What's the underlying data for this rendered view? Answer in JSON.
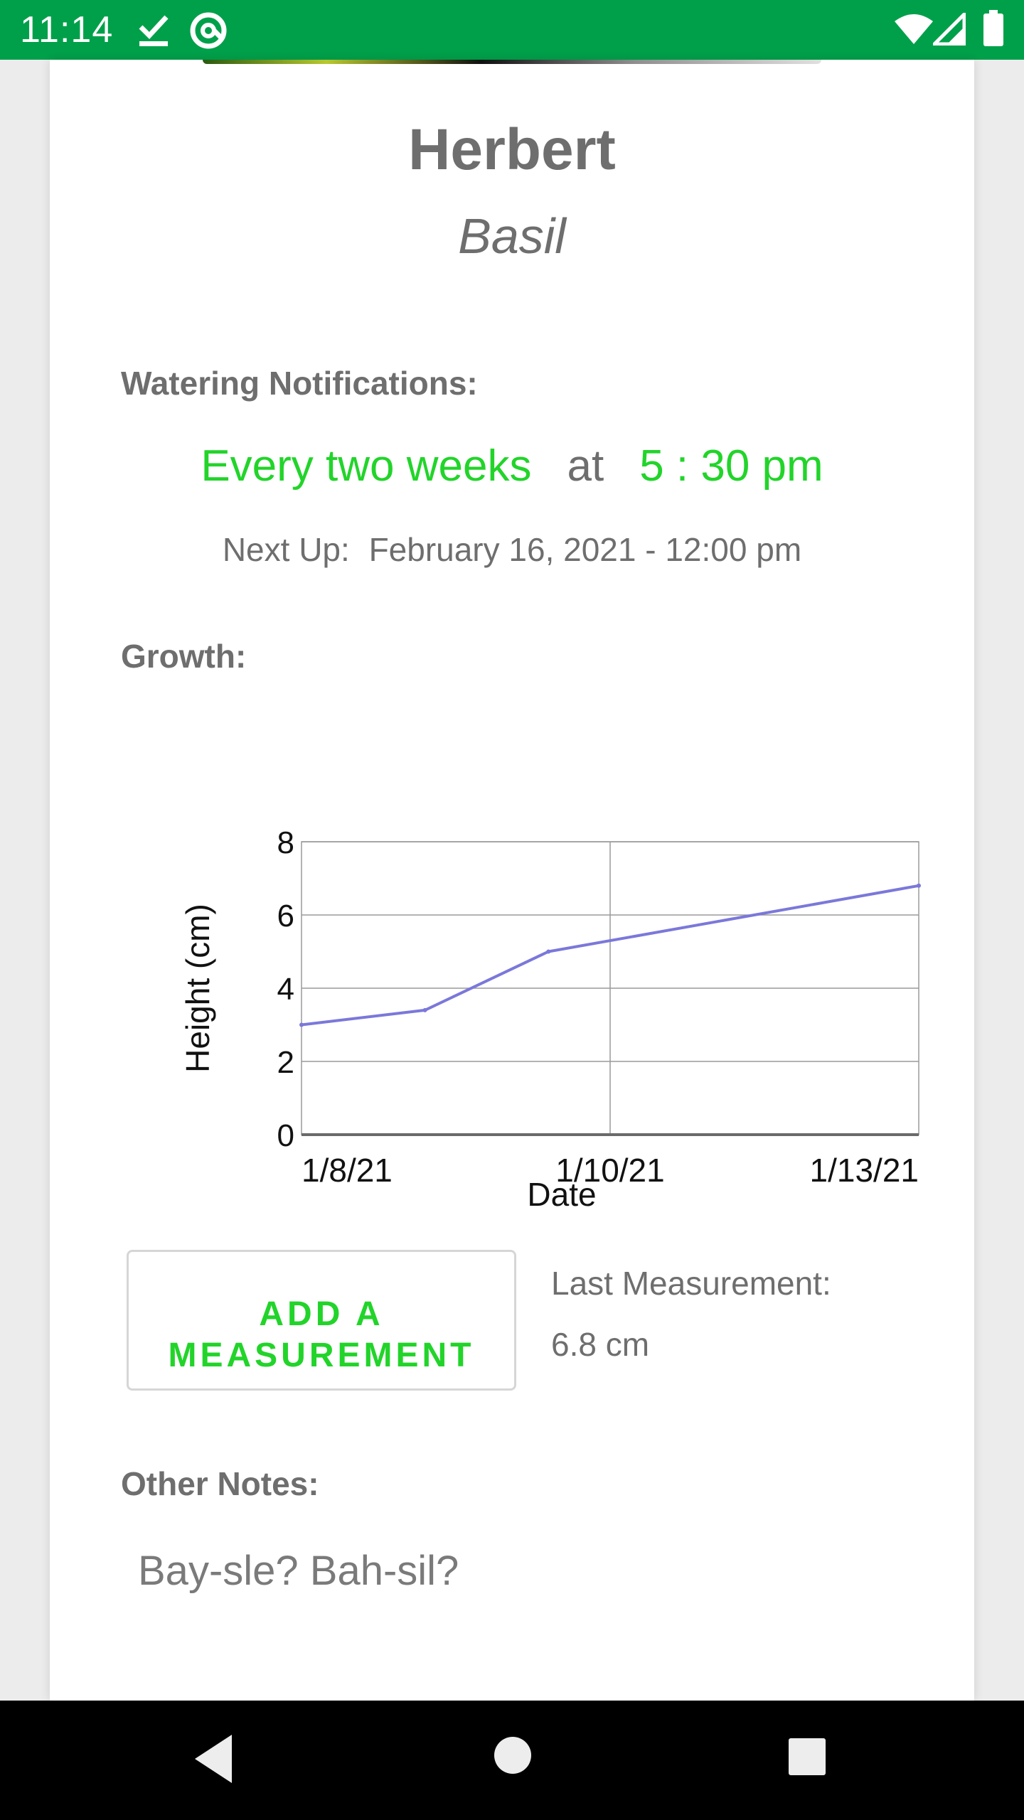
{
  "status_bar": {
    "time": "11:14",
    "icons": [
      "check-download-icon",
      "at-sign-icon",
      "wifi-icon",
      "signal-icon",
      "battery-icon"
    ],
    "background": "#00a04a"
  },
  "plant": {
    "name": "Herbert",
    "species": "Basil"
  },
  "watering": {
    "label": "Watering Notifications:",
    "frequency": "Every two weeks",
    "at_word": "at",
    "time": "5 : 30 pm",
    "next_up_label": "Next Up:",
    "next_up_value": "February 16, 2021 - 12:00 pm"
  },
  "growth": {
    "label": "Growth:"
  },
  "chart_data": {
    "type": "line",
    "x": [
      "2021-01-08",
      "2021-01-09",
      "2021-01-10",
      "2021-01-13"
    ],
    "series": [
      {
        "values": [
          3.0,
          3.4,
          5.0,
          6.8
        ],
        "color": "#7b78da"
      }
    ],
    "x_tick_labels": [
      "1/8/21",
      "1/10/21",
      "1/13/21"
    ],
    "y_ticks": [
      0,
      2,
      4,
      6,
      8
    ],
    "ylim": [
      0,
      8
    ],
    "xlabel": "Date",
    "ylabel": "Height (cm)",
    "grid": true
  },
  "measurement": {
    "button_label_line1": "ADD A",
    "button_label_line2": "MEASUREMENT",
    "last_label": "Last Measurement:",
    "last_value": "6.8 cm"
  },
  "notes": {
    "label": "Other Notes:",
    "text": "Bay-sle? Bah-sil?"
  },
  "nav": {
    "buttons": [
      "back-icon",
      "home-icon",
      "recents-icon"
    ]
  },
  "colors": {
    "accent": "#22d42a",
    "text": "#6e6e6e",
    "series": "#7b78da"
  }
}
